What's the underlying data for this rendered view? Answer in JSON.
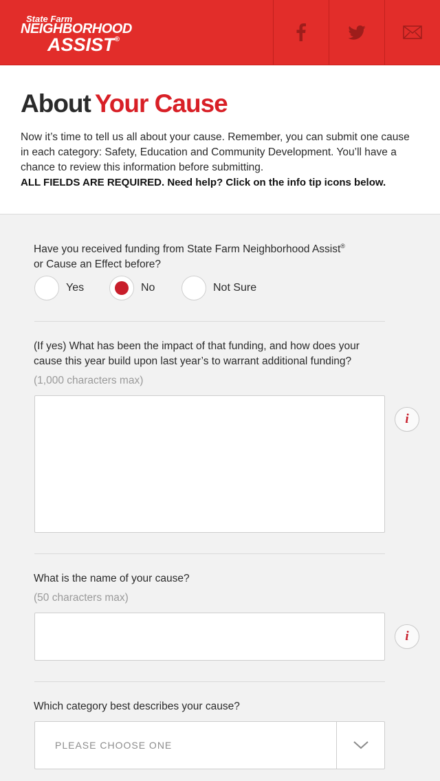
{
  "header": {
    "brand": "State Farm",
    "logo_line1": "NEIGHBORHOOD",
    "logo_line2": "ASSIST",
    "logo_reg": "®",
    "social": [
      {
        "icon": "facebook-icon"
      },
      {
        "icon": "twitter-icon"
      },
      {
        "icon": "mail-icon"
      }
    ],
    "colors": {
      "header_bg": "#e22d2a"
    }
  },
  "intro": {
    "title_part1": "About",
    "title_part2": "Your Cause",
    "text": "Now it’s time to tell us all about your cause. Remember, you can submit one cause in each category: Safety, Education and Community Development. You’ll have a chance to review this information before submitting.",
    "required_note": "ALL FIELDS ARE REQUIRED. Need help? Click on the info tip icons below."
  },
  "form": {
    "q1": {
      "label_line1": "Have you received funding from State Farm Neighborhood Assist",
      "label_reg": "®",
      "label_line2": "or Cause an Effect before?",
      "options": [
        "Yes",
        "No",
        "Not Sure"
      ],
      "selected": "No"
    },
    "q2": {
      "label": "(If yes) What has been the impact of that funding, and how does your cause this year build upon last year’s to warrant additional funding?",
      "hint": "(1,000 characters max)",
      "value": ""
    },
    "q3": {
      "label": "What is the name of your cause?",
      "hint": "(50 characters max)",
      "value": ""
    },
    "q4": {
      "label": "Which category best describes your cause?",
      "placeholder": "PLEASE CHOOSE ONE"
    },
    "info_glyph": "i",
    "accent": "#c81e2b"
  }
}
